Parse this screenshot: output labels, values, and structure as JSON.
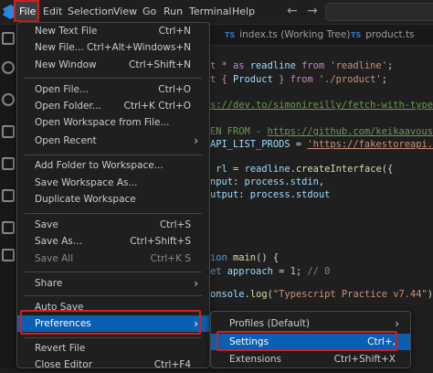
{
  "menubar": {
    "items": [
      "File",
      "Edit",
      "Selection",
      "View",
      "Go",
      "Run",
      "Terminal",
      "Help"
    ],
    "back_icon": "arrow-left-icon",
    "forward_icon": "arrow-right-icon"
  },
  "tabs": [
    {
      "badge": "TS",
      "label": "index.ts (Working Tree)"
    },
    {
      "badge": "TS",
      "label": "product.ts"
    }
  ],
  "file_menu": {
    "items": [
      {
        "label": "New Text File",
        "kbd": "Ctrl+N"
      },
      {
        "label": "New File...",
        "kbd": "Ctrl+Alt+Windows+N"
      },
      {
        "label": "New Window",
        "kbd": "Ctrl+Shift+N"
      },
      {
        "label": "Open File...",
        "kbd": "Ctrl+O"
      },
      {
        "label": "Open Folder...",
        "kbd": "Ctrl+K Ctrl+O"
      },
      {
        "label": "Open Workspace from File...",
        "kbd": ""
      },
      {
        "label": "Open Recent",
        "kbd": ""
      },
      {
        "label": "Add Folder to Workspace...",
        "kbd": ""
      },
      {
        "label": "Save Workspace As...",
        "kbd": ""
      },
      {
        "label": "Duplicate Workspace",
        "kbd": ""
      },
      {
        "label": "Save",
        "kbd": "Ctrl+S"
      },
      {
        "label": "Save As...",
        "kbd": "Ctrl+Shift+S"
      },
      {
        "label": "Save All",
        "kbd": "Ctrl+K S"
      },
      {
        "label": "Share",
        "kbd": ""
      },
      {
        "label": "Auto Save",
        "kbd": ""
      },
      {
        "label": "Preferences",
        "kbd": ""
      },
      {
        "label": "Revert File",
        "kbd": ""
      },
      {
        "label": "Close Editor",
        "kbd": "Ctrl+F4"
      }
    ]
  },
  "preferences_submenu": {
    "items": [
      {
        "label": "Profiles (Default)",
        "kbd": ""
      },
      {
        "label": "Settings",
        "kbd": "Ctrl+,"
      },
      {
        "label": "Extensions",
        "kbd": "Ctrl+Shift+X"
      }
    ]
  },
  "code": {
    "l1a": "t * as ",
    "l1b": "readline",
    "l1c": " from ",
    "l1d": "'readline'",
    "l1e": ";",
    "l2a": "t { ",
    "l2b": "Product",
    "l2c": " } from ",
    "l2d": "'./product'",
    "l2e": ";",
    "l3a": "s://dev.to/simonireilly/fetch-with-typescr",
    "l4a": "EN FROM - ",
    "l4b": "https://github.com/keikaavousi/fake",
    "l5a": "API_LIST_PRODS",
    "l5b": " = ",
    "l5c": "'https://fakestoreapi.com/",
    "l6a": " rl",
    "l6b": " = ",
    "l6c": "readline",
    "l6d": ".",
    "l6e": "createInterface",
    "l6f": "({",
    "l7a": "nput",
    "l7b": ": ",
    "l7c": "process",
    "l7d": ".",
    "l7e": "stdin",
    "l7f": ",",
    "l8a": "utput",
    "l8b": ": ",
    "l8c": "process",
    "l8d": ".",
    "l8e": "stdout",
    "l9a": "ion ",
    "l9b": "main",
    "l9c": "() {",
    "l10a": "et ",
    "l10b": "approach",
    "l10c": " = ",
    "l10d": "1",
    "l10e": "; ",
    "l10f": "// 0",
    "l11a": "onsole",
    "l11b": ".",
    "l11c": "log",
    "l11d": "(",
    "l11e": "\"Typescript Practice v7.44\"",
    "l11f": ");"
  }
}
